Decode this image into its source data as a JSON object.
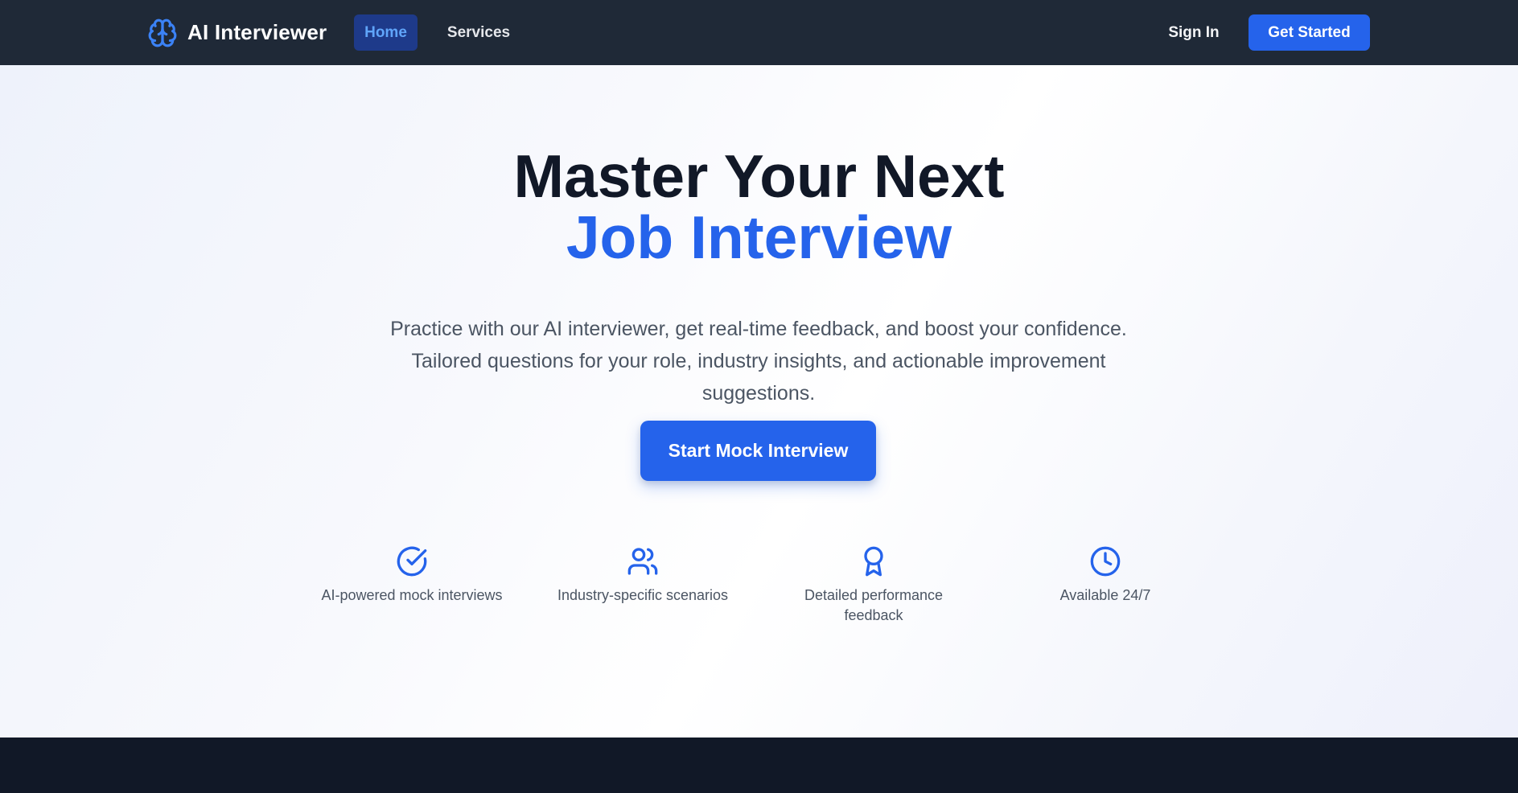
{
  "brand": {
    "name": "AI Interviewer",
    "icon": "brain-icon"
  },
  "nav": {
    "home": "Home",
    "services": "Services",
    "sign_in": "Sign In",
    "get_started": "Get Started"
  },
  "hero": {
    "headline_line1": "Master Your Next",
    "headline_line2": "Job Interview",
    "subtitle": "Practice with our AI interviewer, get real-time feedback, and boost your confidence. Tailored questions for your role, industry insights, and actionable improvement suggestions.",
    "cta": "Start Mock Interview"
  },
  "features": [
    {
      "label": "AI-powered mock interviews",
      "icon": "check-circle-icon"
    },
    {
      "label": "Industry-specific scenarios",
      "icon": "users-icon"
    },
    {
      "label": "Detailed performance feedback",
      "icon": "award-icon"
    },
    {
      "label": "Available 24/7",
      "icon": "clock-icon"
    }
  ],
  "colors": {
    "navbar_bg": "#1f2937",
    "accent": "#2563eb",
    "active_nav_bg": "#1e3a8a",
    "active_nav_text": "#60a5fa",
    "headline_dark": "#111827",
    "body_text": "#4b5563",
    "footer_bg": "#111827"
  }
}
